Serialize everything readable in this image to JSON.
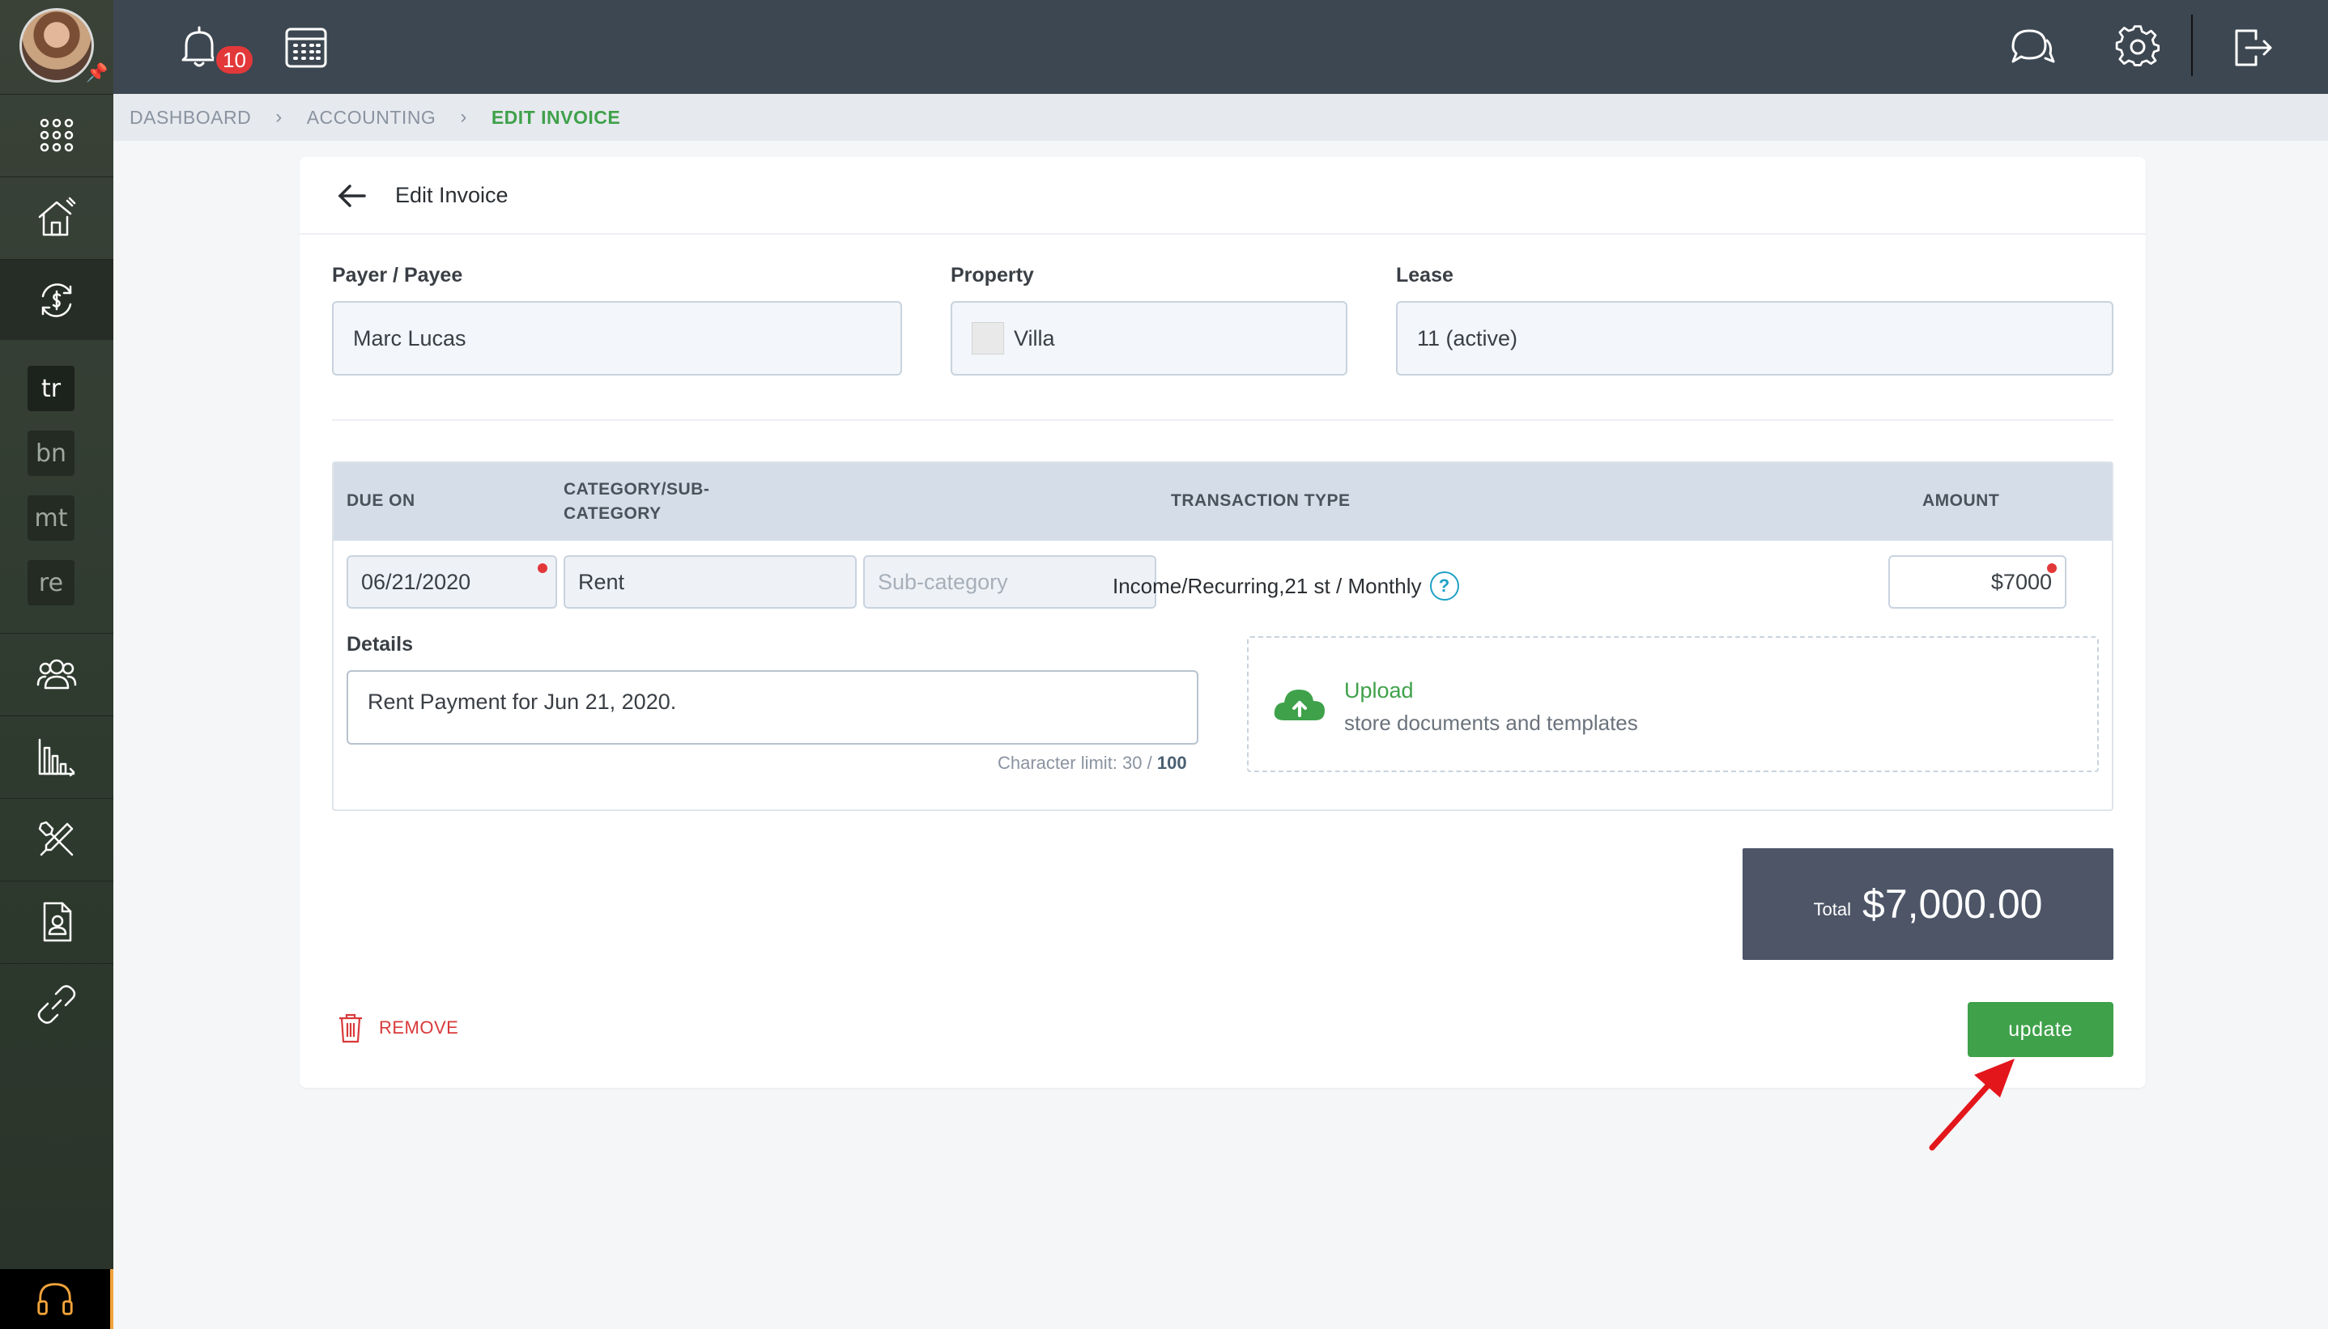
{
  "topbar": {
    "notification_count": "10"
  },
  "sidebar": {
    "tags": [
      "tr",
      "bn",
      "mt",
      "re"
    ]
  },
  "breadcrumb": {
    "items": [
      "DASHBOARD",
      "ACCOUNTING",
      "EDIT INVOICE"
    ]
  },
  "card": {
    "title": "Edit Invoice"
  },
  "fields": {
    "payer_label": "Payer / Payee",
    "payer_value": "Marc Lucas",
    "property_label": "Property",
    "property_value": "Villa",
    "lease_label": "Lease",
    "lease_value": "11 (active)"
  },
  "table": {
    "headers": {
      "due_on": "DUE ON",
      "category_line1": "CATEGORY/SUB-",
      "category_line2": "CATEGORY",
      "transaction_type": "TRANSACTION TYPE",
      "amount": "AMOUNT"
    },
    "row": {
      "due_on": "06/21/2020",
      "category": "Rent",
      "subcategory_placeholder": "Sub-category",
      "transaction_type": "Income/Recurring,21 st / Monthly",
      "help": "?",
      "amount": "$7000"
    }
  },
  "details": {
    "label": "Details",
    "value": "Rent Payment for Jun 21, 2020.",
    "char_limit_prefix": "Character limit: 30 / ",
    "char_limit_max": "100"
  },
  "upload": {
    "title": "Upload",
    "subtitle": "store documents and templates"
  },
  "total": {
    "label": "Total",
    "value": "$7,000.00"
  },
  "actions": {
    "remove_label": "REMOVE",
    "update_label": "update"
  },
  "colors": {
    "accent_green": "#3fa14a",
    "topbar": "#3d4751",
    "danger": "#d9393a",
    "annotation": "#e3161b"
  }
}
